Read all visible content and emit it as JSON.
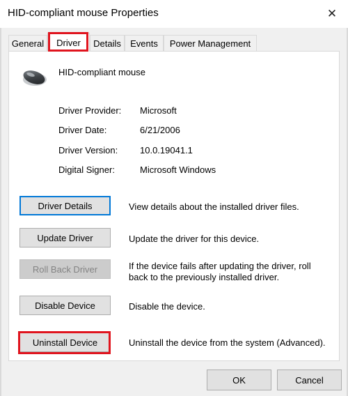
{
  "window": {
    "title": "HID-compliant mouse Properties",
    "close_glyph": "✕",
    "highlight_color": "#e0141e"
  },
  "tabs": [
    {
      "label": "General",
      "active": false
    },
    {
      "label": "Driver",
      "active": true
    },
    {
      "label": "Details",
      "active": false
    },
    {
      "label": "Events",
      "active": false
    },
    {
      "label": "Power Management",
      "active": false
    }
  ],
  "device": {
    "icon": "mouse-icon",
    "name": "HID-compliant mouse"
  },
  "properties": [
    {
      "label": "Driver Provider:",
      "value": "Microsoft"
    },
    {
      "label": "Driver Date:",
      "value": "6/21/2006"
    },
    {
      "label": "Driver Version:",
      "value": "10.0.19041.1"
    },
    {
      "label": "Digital Signer:",
      "value": "Microsoft Windows"
    }
  ],
  "actions": [
    {
      "label": "Driver Details",
      "description": "View details about the installed driver files.",
      "enabled": true,
      "focused": true
    },
    {
      "label": "Update Driver",
      "description": "Update the driver for this device.",
      "enabled": true
    },
    {
      "label": "Roll Back Driver",
      "description": "If the device fails after updating the driver, roll back to the previously installed driver.",
      "enabled": false
    },
    {
      "label": "Disable Device",
      "description": "Disable the device.",
      "enabled": true
    },
    {
      "label": "Uninstall Device",
      "description": "Uninstall the device from the system (Advanced).",
      "enabled": true,
      "highlighted": true
    }
  ],
  "footer": {
    "ok_label": "OK",
    "cancel_label": "Cancel"
  }
}
